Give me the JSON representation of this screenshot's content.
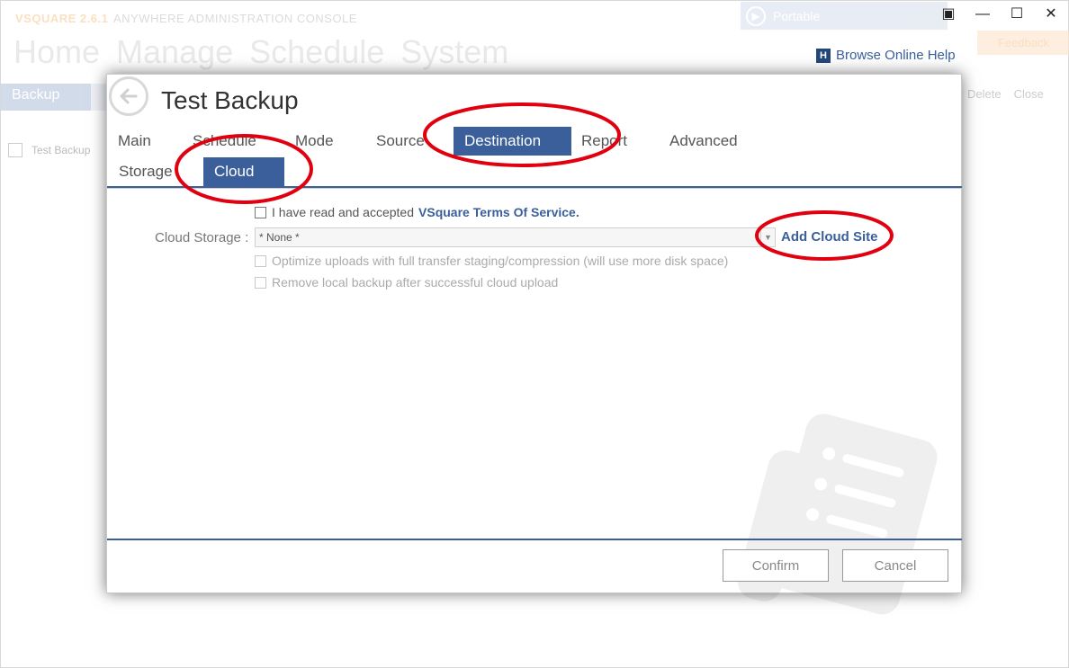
{
  "app": {
    "brand": "VSQUARE 2.6.1",
    "subtitle": "ANYWHERE ADMINISTRATION CONSOLE",
    "nav": [
      "Home",
      "Manage",
      "Schedule",
      "System"
    ],
    "portable_label": "Portable",
    "help_label": "Browse Online Help",
    "feedback_label": "Feedback",
    "side_tab": "Backup",
    "tree_item": "Test Backup",
    "right_tools": [
      "Delete",
      "Close"
    ]
  },
  "dialog": {
    "title": "Test Backup",
    "tabs": [
      "Main",
      "Schedule",
      "Mode",
      "Source",
      "Destination",
      "Report",
      "Advanced"
    ],
    "active_tab": "Destination",
    "subtabs": [
      "Storage",
      "Cloud"
    ],
    "active_subtab": "Cloud",
    "terms": {
      "text": "I have read and accepted",
      "link": "VSquare Terms Of Service."
    },
    "cloud_storage": {
      "label": "Cloud Storage :",
      "value": "* None *",
      "add_link": "Add Cloud Site"
    },
    "optimize_label": "Optimize uploads with full transfer staging/compression (will use more disk space)",
    "remove_local_label": "Remove local backup after successful cloud upload",
    "buttons": {
      "confirm": "Confirm",
      "cancel": "Cancel"
    }
  },
  "colors": {
    "accent": "#3a5f9a",
    "annotation": "#e0000f"
  }
}
